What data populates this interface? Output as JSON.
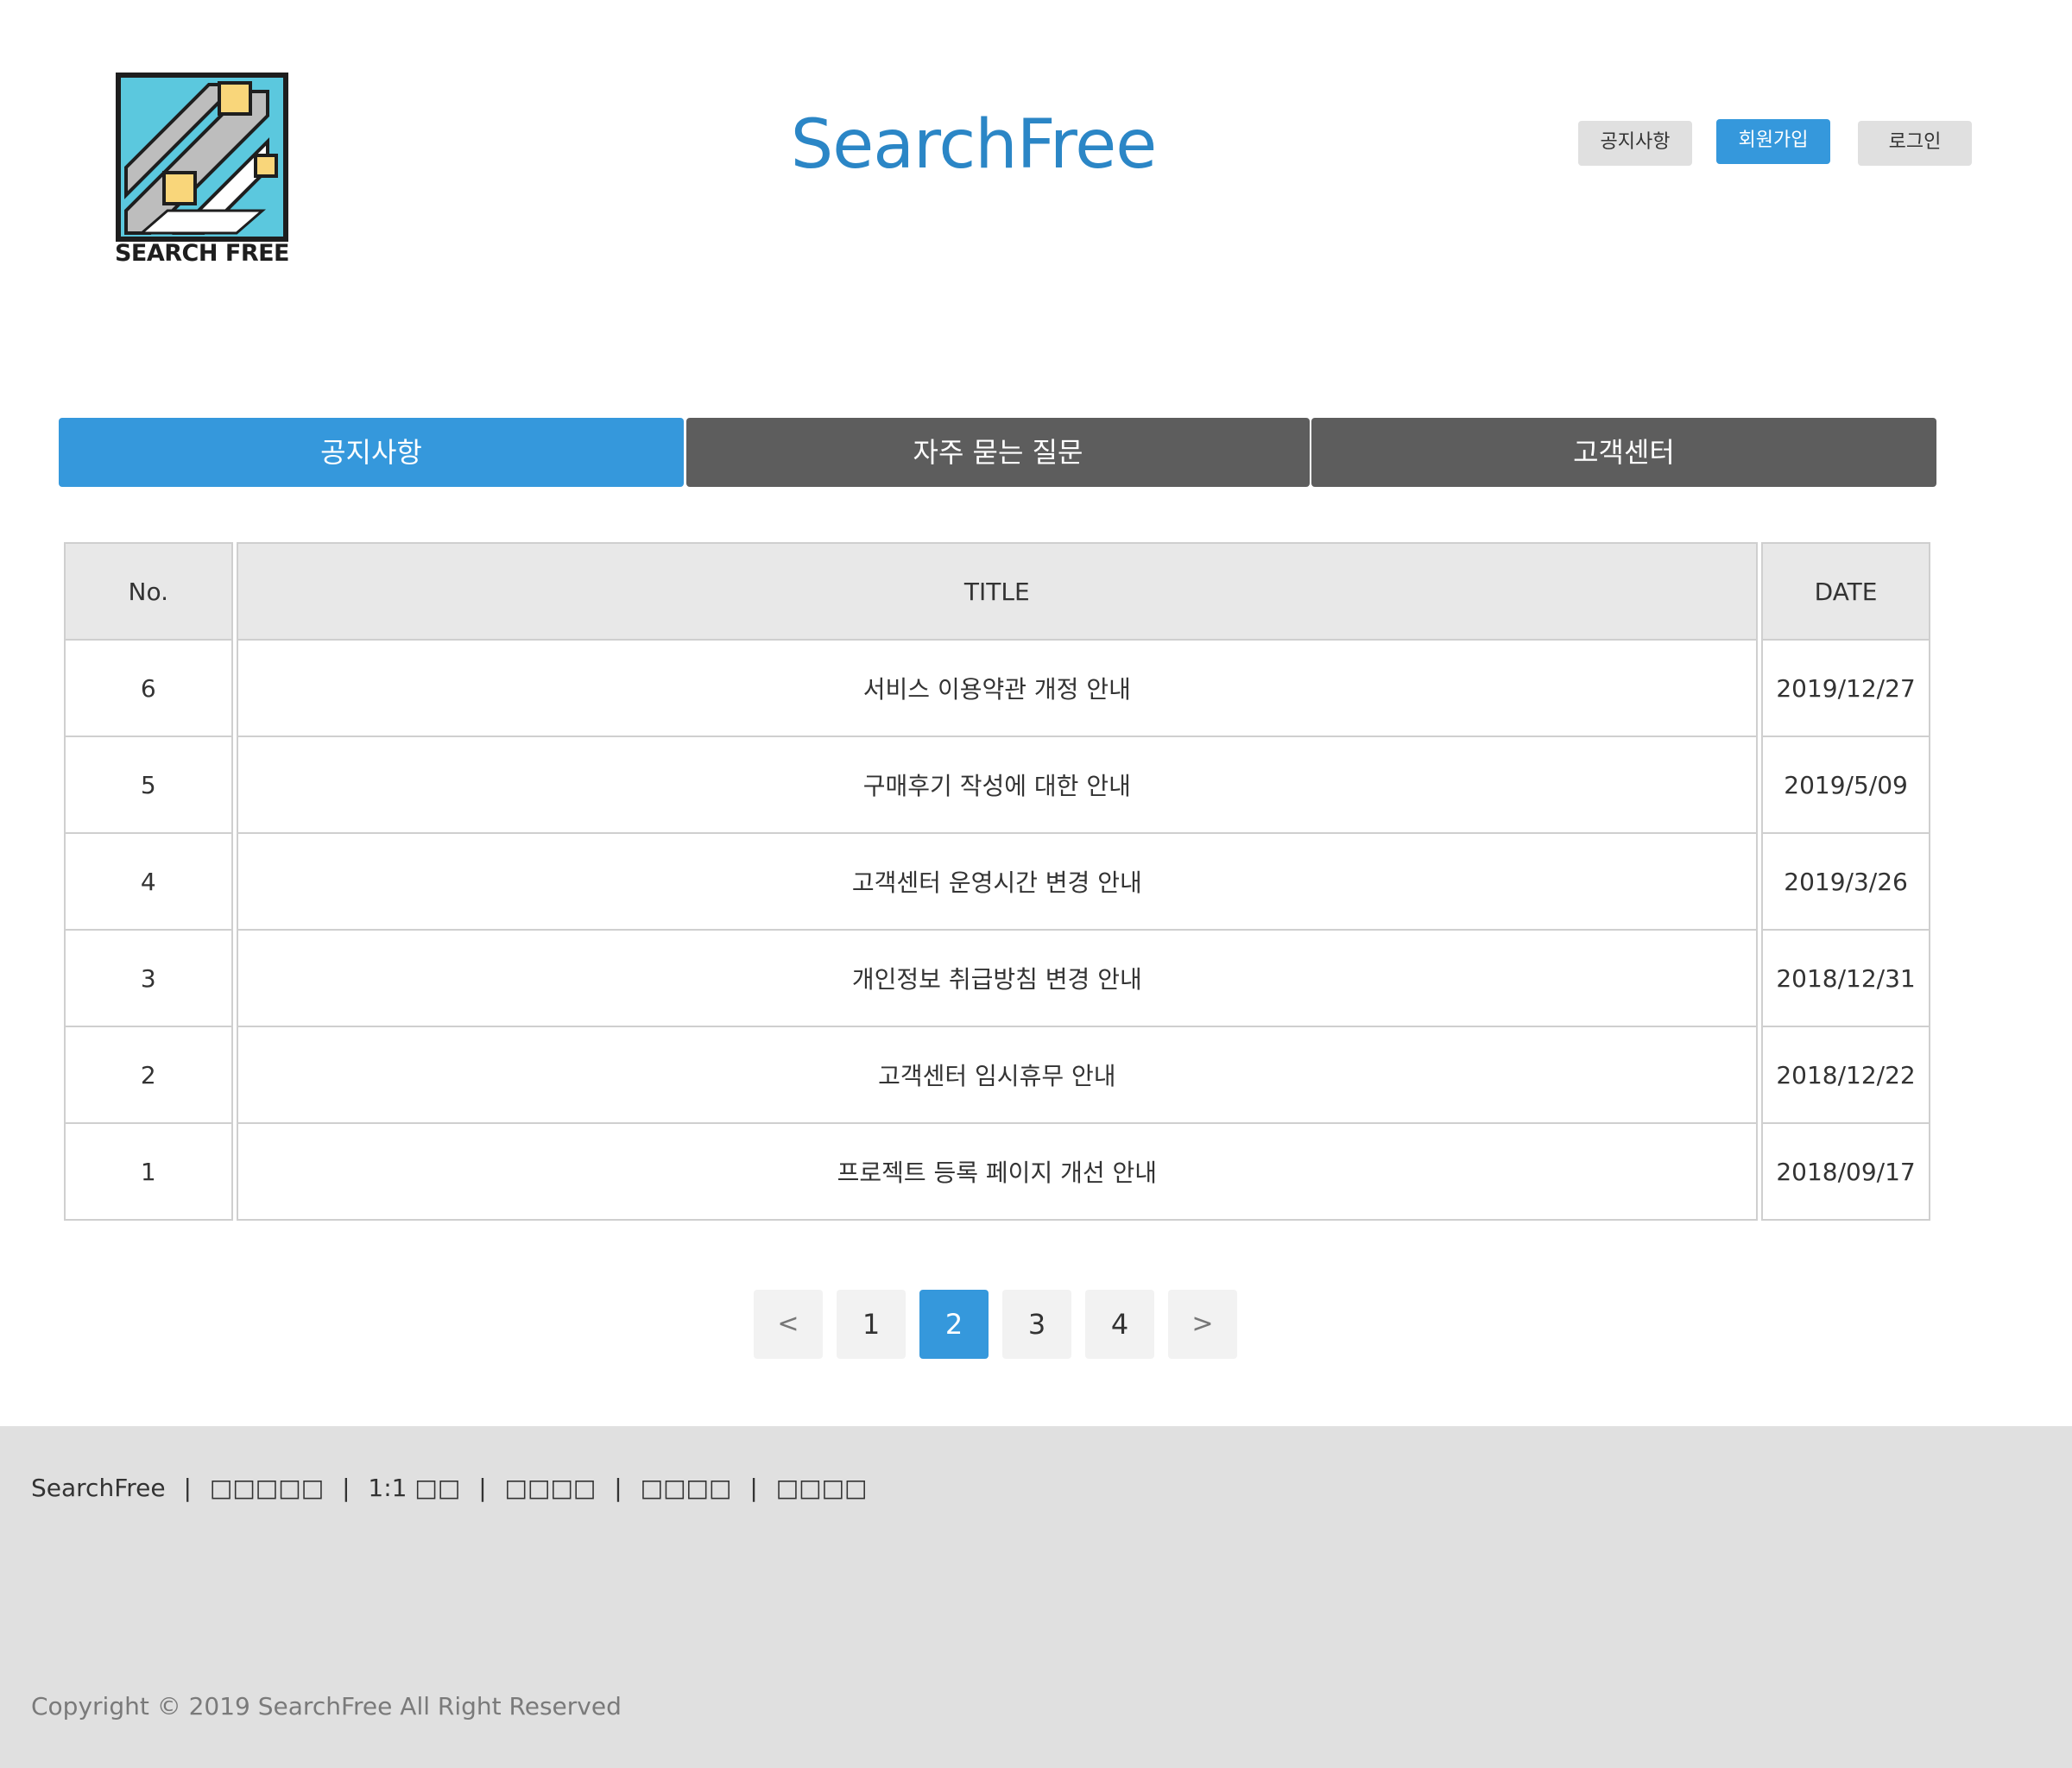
{
  "header": {
    "logo_text": "SEARCH FREE",
    "site_title": "SearchFree",
    "buttons": {
      "notice": "공지사항",
      "signup": "회원가입",
      "login": "로그인"
    }
  },
  "tabs": [
    {
      "label": "공지사항",
      "active": true
    },
    {
      "label": "자주 묻는 질문",
      "active": false
    },
    {
      "label": "고객센터",
      "active": false
    }
  ],
  "table": {
    "headers": {
      "no": "No.",
      "title": "TITLE",
      "date": "DATE"
    },
    "rows": [
      {
        "no": "6",
        "title": "서비스 이용약관 개정 안내",
        "date": "2019/12/27"
      },
      {
        "no": "5",
        "title": "구매후기 작성에 대한 안내",
        "date": "2019/5/09"
      },
      {
        "no": "4",
        "title": "고객센터 운영시간 변경 안내",
        "date": "2019/3/26"
      },
      {
        "no": "3",
        "title": "개인정보 취급방침 변경 안내",
        "date": "2018/12/31"
      },
      {
        "no": "2",
        "title": "고객센터 임시휴무 안내",
        "date": "2018/12/22"
      },
      {
        "no": "1",
        "title": "프로젝트 등록 페이지 개선 안내",
        "date": "2018/09/17"
      }
    ]
  },
  "pagination": {
    "prev": "<",
    "pages": [
      "1",
      "2",
      "3",
      "4"
    ],
    "current": "2",
    "next": ">"
  },
  "footer": {
    "brand": "SearchFree",
    "links": [
      "□□□□□",
      "1:1 □□",
      "□□□□",
      "□□□□",
      "□□□□"
    ],
    "separator": "|",
    "copyright": "Copyright © 2019 SearchFree All Right Reserved"
  },
  "colors": {
    "accent": "#3598dc",
    "title": "#2b86c6",
    "tab_idle": "#5d5d5d",
    "footer_bg": "#e0e0e0",
    "logo_cyan": "#5bc8de",
    "logo_yellow": "#f9d67a"
  },
  "icons": {
    "logo": "search-free-logo-icon"
  }
}
